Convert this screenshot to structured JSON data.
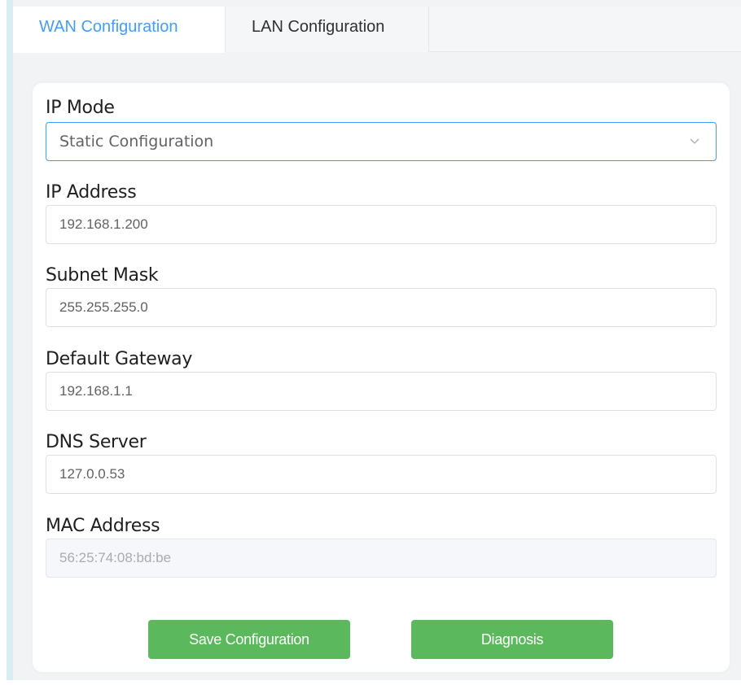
{
  "tabs": [
    {
      "label": "WAN Configuration",
      "active": true
    },
    {
      "label": "LAN Configuration",
      "active": false
    }
  ],
  "form": {
    "ip_mode": {
      "label": "IP Mode",
      "value": "Static Configuration"
    },
    "ip_address": {
      "label": "IP Address",
      "value": "192.168.1.200"
    },
    "subnet_mask": {
      "label": "Subnet Mask",
      "value": "255.255.255.0"
    },
    "default_gateway": {
      "label": "Default Gateway",
      "value": "192.168.1.1"
    },
    "dns_server": {
      "label": "DNS Server",
      "value": "127.0.0.53"
    },
    "mac_address": {
      "label": "MAC Address",
      "value": "56:25:74:08:bd:be"
    }
  },
  "buttons": {
    "save": "Save Configuration",
    "diagnosis": "Diagnosis"
  },
  "colors": {
    "accent": "#409eff",
    "button": "#5cb85c"
  },
  "icons": {
    "select": "chevron-down-icon"
  }
}
